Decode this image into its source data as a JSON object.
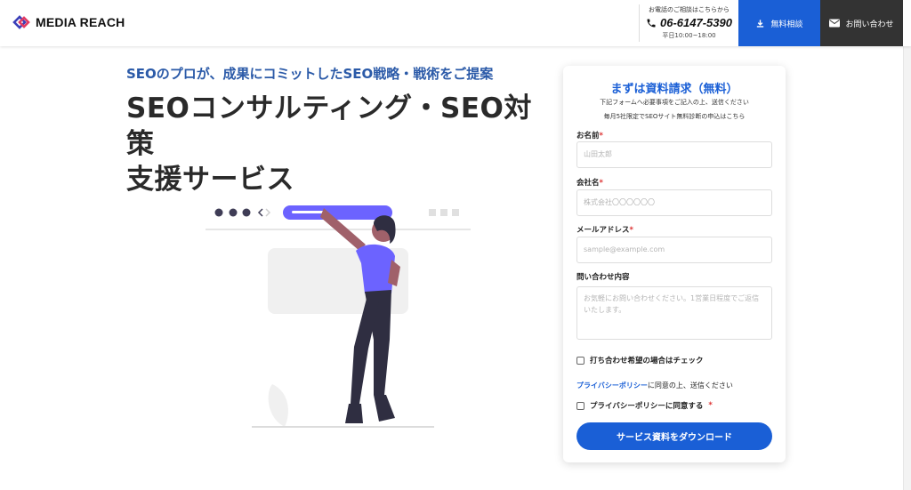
{
  "header": {
    "logo_text": "MEDIA REACH",
    "phone_note": "お電話のご相談はこちらから",
    "phone_number": "06-6147-5390",
    "phone_hours": "平日10:00~18:00",
    "consult_label": "無料相談",
    "contact_label": "お問い合わせ"
  },
  "hero": {
    "subhead": "SEOのプロが、成果にコミットしたSEO戦略・戦術をご提案",
    "title_line1": "SEOコンサルティング・SEO対策",
    "title_line2": "支援サービス"
  },
  "form": {
    "title": "まずは資料請求（無料）",
    "note1": "下記フォームへ必要事項をご記入の上、送信ください",
    "note2": "毎月5社限定でSEOサイト無料診断の申込はこちら",
    "name_label": "お名前",
    "name_placeholder": "山田太郎",
    "company_label": "会社名",
    "company_placeholder": "株式会社〇〇〇〇〇〇",
    "email_label": "メールアドレス",
    "email_placeholder": "sample@example.com",
    "inquiry_label": "問い合わせ内容",
    "inquiry_placeholder": "お気軽にお問い合わせください。1営業日程度でご返信いたします。",
    "required_mark": "*",
    "meeting_check_label": "打ち合わせ希望の場合はチェック",
    "policy_link": "プライバシーポリシー",
    "policy_text": "に同意の上、送信ください",
    "policy_check_label": "プライバシーポリシーに同意する",
    "submit_label": "サービス資料をダウンロード"
  },
  "colors": {
    "accent": "#1a5fd6",
    "subhead": "#2b5aa8",
    "illustration_purple": "#6c63ff",
    "dark_button": "#333333"
  }
}
